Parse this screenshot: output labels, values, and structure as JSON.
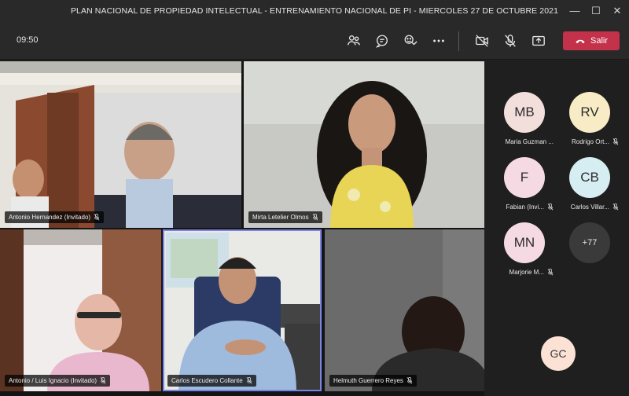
{
  "window": {
    "title": "PLAN NACIONAL DE PROPIEDAD INTELECTUAL - ENTRENAMIENTO NACIONAL DE PI - MIERCOLES 27 DE OCTUBRE 2021"
  },
  "toolbar": {
    "time": "09:50",
    "leave_label": "Salir",
    "icons": [
      "people-icon",
      "chat-icon",
      "reactions-icon",
      "more-icon",
      "camera-off-icon",
      "mic-off-icon",
      "share-icon",
      "phone-icon"
    ]
  },
  "video_tiles": [
    {
      "name": "Antonio Hernandez (Invitado)",
      "muted": true
    },
    {
      "name": "Mirta Letelier Olmos",
      "muted": true
    },
    {
      "name": "Antonio / Luis Ignacio (Invitado)",
      "muted": true
    },
    {
      "name": "Carlos Escudero Collante",
      "muted": true,
      "active_speaker": true
    },
    {
      "name": "Helmuth Guerrero Reyes",
      "muted": true
    }
  ],
  "roster": [
    {
      "initials": "MB",
      "name": "Maria Guzman ...",
      "color": "#f2dedb",
      "muted": false
    },
    {
      "initials": "RV",
      "name": "Rodrigo Ort...",
      "color": "#f7ecc5",
      "muted": true
    },
    {
      "initials": "F",
      "name": "Fabian (Invi...",
      "color": "#f5d9e3",
      "muted": true
    },
    {
      "initials": "CB",
      "name": "Carlos Villar...",
      "color": "#d6edf2",
      "muted": true
    },
    {
      "initials": "MN",
      "name": "Marjorie M...",
      "color": "#f5d9e3",
      "muted": true
    },
    {
      "initials": "+77",
      "name": "",
      "color": "#3a3a3a",
      "muted": false
    }
  ],
  "self_view": {
    "initials": "GC"
  },
  "colors": {
    "accent": "#7b83eb",
    "leave": "#c4314b",
    "background": "#1f1f1f"
  }
}
